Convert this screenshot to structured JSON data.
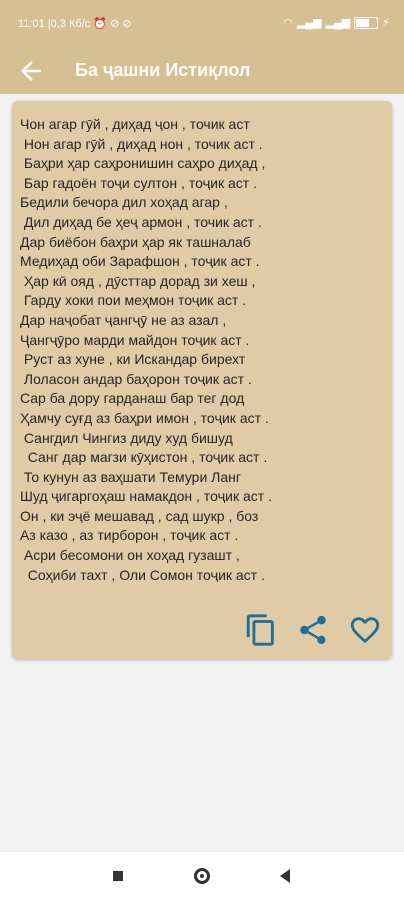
{
  "status": {
    "time": "11:01",
    "speed": "0,3 Кб/с",
    "battery": "63",
    "battery_level": 0.63
  },
  "appbar": {
    "title": "Ба ҷашни Истиқлол",
    "back_icon": "arrow-left-icon"
  },
  "poem": {
    "lines": [
      "Чон агар гӯй , диҳад ҷон , точик аст",
      " Нон агар гӯй , диҳад нон , точик аст .",
      " Баҳри ҳар саҳронишин саҳро диҳад ,",
      " Бар гадоён тоҷи султон , тоҷик аст .",
      "Бедили бечора дил хоҳад агар ,",
      " Дил диҳад бе ҳеҷ армон , точик аст .",
      "Дар биёбон баҳри ҳар як ташналаб",
      "Медиҳад оби Зарафшон , тоҷик аст .",
      " Ҳар кӣ ояд , дӯсттар дорад зи хеш ,",
      " Гарду хоки пои меҳмон тоҷик аст .",
      "Дар наҷобат ҷангҷӯ не аз азал ,",
      "Ҷангҷӯро марди майдон тоҷик аст .",
      " Руст аз хуне , ки Искандар бирехт",
      " Лоласон андар баҳорон тоҷик аст .",
      "Сар ба дору гарданаш бар тег дод",
      "Ҳамчу суғд аз баҳри имон , тоҷик аст .",
      " Сангдил Чингиз диду худ бишуд",
      "  Санг дар магзи кӯҳистон , тоҷик аст .",
      " То кунун аз ваҳшати Темури Ланг",
      "Шуд ҷигаргоҳаш намакдон , тоҷик аст .",
      "Он , ки эҷё мешавад , сад шукр , боз",
      "Аз казо , аз тирборон , тоҷик аст .",
      " Асри бесомони он хоҳад гузашт ,",
      "  Соҳиби тахт , Оли Сомон тоҷик аст ."
    ]
  },
  "actions": {
    "copy_icon": "copy-icon",
    "share_icon": "share-icon",
    "favorite_icon": "heart-icon",
    "color": "#1f6f96"
  },
  "navbar": {
    "recents_icon": "square-icon",
    "home_icon": "circle-icon",
    "back_icon": "triangle-back-icon"
  },
  "colors": {
    "appbar": "#d5bf93",
    "card": "#dfcba6",
    "background": "#f2f2f2"
  }
}
